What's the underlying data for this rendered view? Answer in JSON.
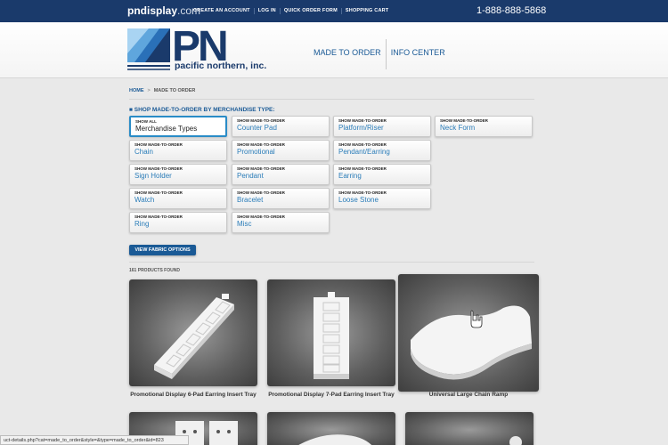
{
  "topbar": {
    "site_name": "pndisplay",
    "site_tld": ".com",
    "links": [
      "CREATE AN ACCOUNT",
      "LOG IN",
      "QUICK ORDER FORM",
      "SHOPPING CART"
    ],
    "phone": "1-888-888-5868"
  },
  "header": {
    "logo_text": "PN",
    "logo_subtitle": "pacific northern, inc.",
    "nav": [
      "MADE TO ORDER",
      "INFO CENTER"
    ]
  },
  "breadcrumb": {
    "home": "HOME",
    "current": "MADE TO ORDER"
  },
  "section_title": "SHOP MADE-TO-ORDER BY MERCHANDISE TYPE:",
  "merch_buttons": [
    {
      "sub": "SHOW ALL",
      "title": "Merchandise Types",
      "active": true
    },
    {
      "sub": "SHOW MADE-TO-ORDER",
      "title": "Counter Pad"
    },
    {
      "sub": "SHOW MADE-TO-ORDER",
      "title": "Platform/Riser"
    },
    {
      "sub": "SHOW MADE-TO-ORDER",
      "title": "Neck Form"
    },
    {
      "sub": "SHOW MADE-TO-ORDER",
      "title": "Chain"
    },
    {
      "sub": "SHOW MADE-TO-ORDER",
      "title": "Promotional"
    },
    {
      "sub": "SHOW MADE-TO-ORDER",
      "title": "Pendant/Earring"
    },
    {
      "sub": "SHOW MADE-TO-ORDER",
      "title": "Sign Holder"
    },
    {
      "sub": "SHOW MADE-TO-ORDER",
      "title": "Pendant"
    },
    {
      "sub": "SHOW MADE-TO-ORDER",
      "title": "Earring"
    },
    {
      "sub": "SHOW MADE-TO-ORDER",
      "title": "Watch"
    },
    {
      "sub": "SHOW MADE-TO-ORDER",
      "title": "Bracelet"
    },
    {
      "sub": "SHOW MADE-TO-ORDER",
      "title": "Loose Stone"
    },
    {
      "sub": "SHOW MADE-TO-ORDER",
      "title": "Ring"
    },
    {
      "sub": "SHOW MADE-TO-ORDER",
      "title": "Misc"
    }
  ],
  "fabric_button": "VIEW FABRIC OPTIONS",
  "products_found": "161 PRODUCTS FOUND",
  "products": [
    {
      "name": "Promotional Display 6-Pad Earring Insert Tray"
    },
    {
      "name": "Promotional Display 7-Pad Earring Insert Tray"
    },
    {
      "name": "Universal Large Chain Ramp"
    }
  ],
  "status_url": "uct-details.php?cat=made_to_order&style=&type=made_to_order&id=823",
  "colors": {
    "topbar": "#1a3a6b",
    "link": "#1a5a96",
    "accent": "#2a8cc7"
  }
}
